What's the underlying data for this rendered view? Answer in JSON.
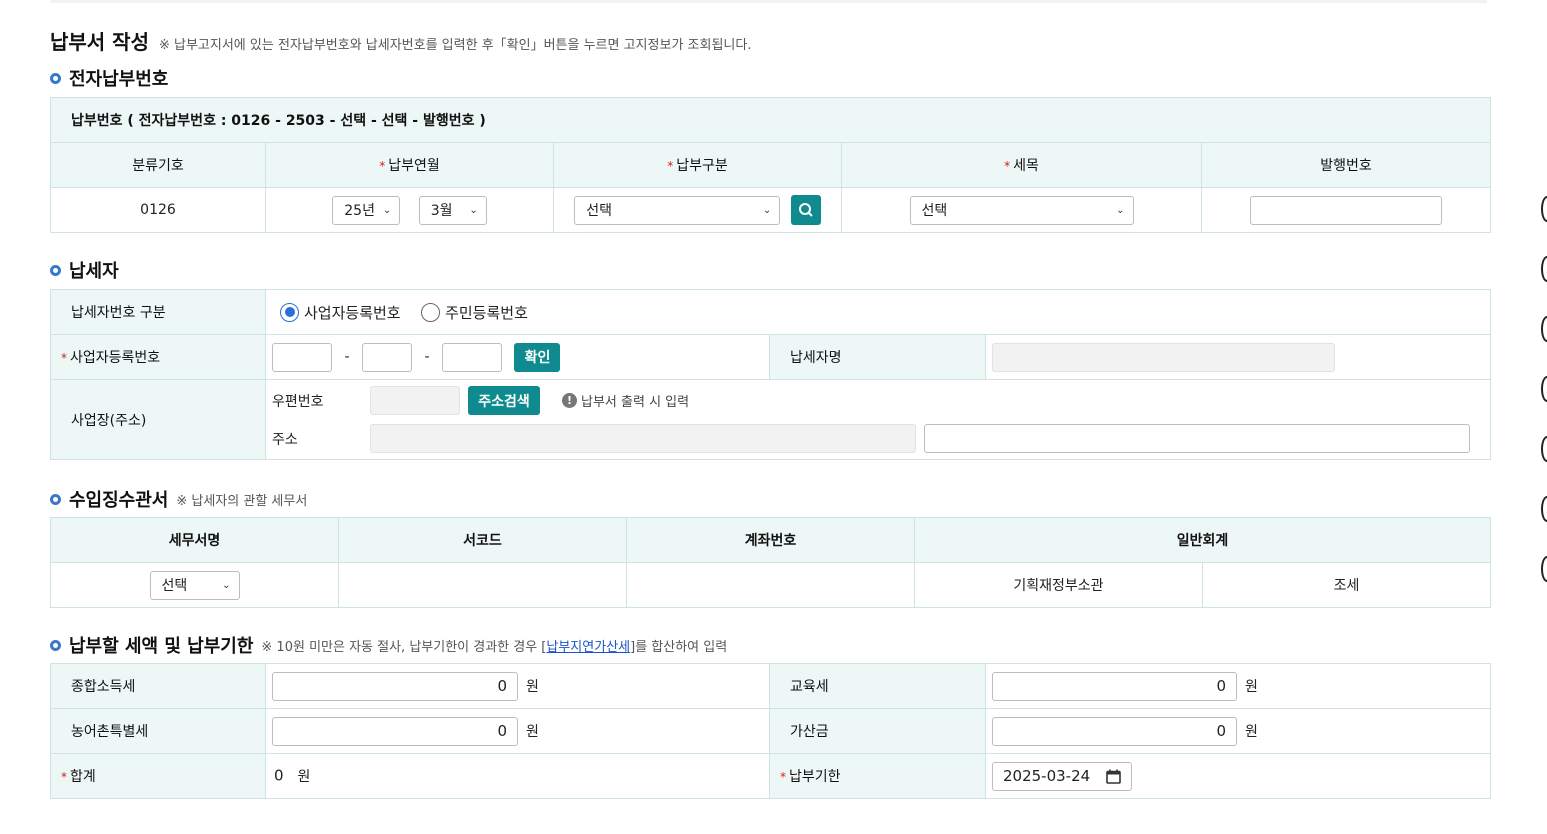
{
  "page": {
    "title": "납부서 작성",
    "note": "※ 납부고지서에 있는 전자납부번호와 납세자번호를 입력한 후「확인」버튼을 누르면 고지정보가 조회됩니다."
  },
  "e_number": {
    "section_title": "전자납부번호",
    "header": "납부번호 ( 전자납부번호 : 0126 - 2503 - 선택 - 선택 - 발행번호 )",
    "columns": [
      "분류기호",
      "납부연월",
      "납부구분",
      "세목",
      "발행번호"
    ],
    "classification_code": "0126",
    "year": "25년",
    "month": "3월",
    "payment_type": "선택",
    "tax_item": "선택",
    "issue_number": ""
  },
  "taxpayer": {
    "section_title": "납세자",
    "id_type_label": "납세자번호 구분",
    "radio_business": "사업자등록번호",
    "radio_resident": "주민등록번호",
    "selected": "business",
    "business_no_label": "사업자등록번호",
    "dash": "-",
    "confirm_button": "확인",
    "name_label": "납세자명",
    "name_value": "",
    "address_label": "사업장(주소)",
    "postcode_label": "우편번호",
    "address_search_button": "주소검색",
    "postcode_note": "납부서 출력 시 입력",
    "address_sub_label": "주소"
  },
  "office": {
    "section_title": "수입징수관서",
    "note": "※ 납세자의 관할 세무서",
    "columns": [
      "세무서명",
      "서코드",
      "계좌번호",
      "일반회계"
    ],
    "office_name": "선택",
    "office_code": "",
    "account_no": "",
    "accounting_1": "기획재정부소관",
    "accounting_2": "조세"
  },
  "amount": {
    "section_title": "납부할 세액 및 납부기한",
    "note_prefix": "※ 10원 미만은 자동 절사, 납부기한이 경과한 경우 [",
    "note_link": "납부지연가산세",
    "note_suffix": "]를 합산하여 입력",
    "income_tax_label": "종합소득세",
    "income_tax_value": "0",
    "education_tax_label": "교육세",
    "education_tax_value": "0",
    "rural_tax_label": "농어촌특별세",
    "rural_tax_value": "0",
    "penalty_label": "가산금",
    "penalty_value": "0",
    "total_label": "합계",
    "total_value": "0",
    "deadline_label": "납부기한",
    "deadline_value": "2025-03-24",
    "unit": "원"
  }
}
